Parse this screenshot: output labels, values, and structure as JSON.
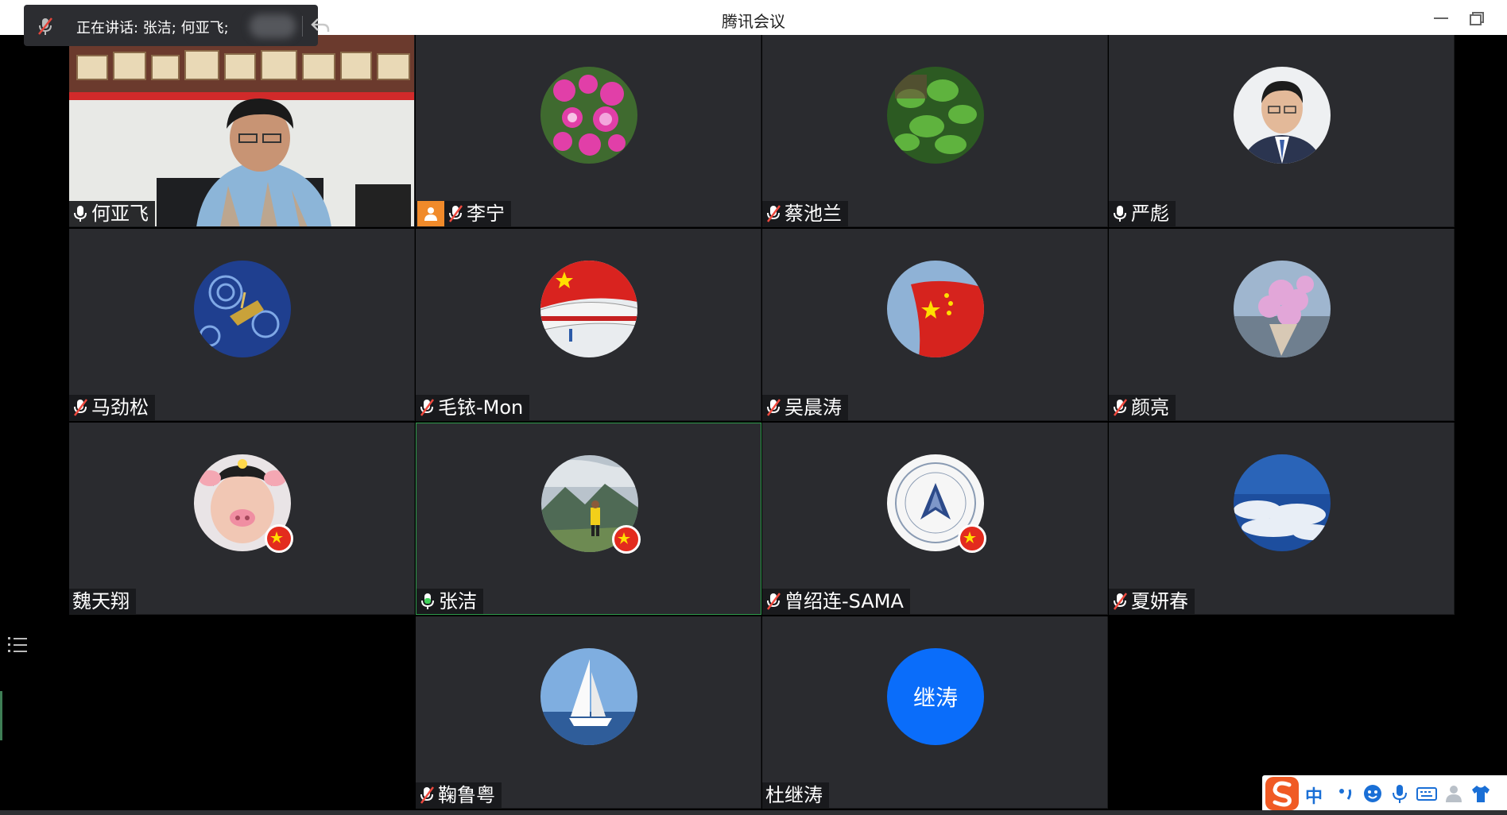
{
  "window": {
    "title": "腾讯会议"
  },
  "speaking": {
    "text": "正在讲话: 张洁; 何亚飞;"
  },
  "participants": [
    {
      "name": "何亚飞",
      "mic": "on",
      "type": "video"
    },
    {
      "name": "李宁",
      "mic": "off",
      "host": true,
      "avatar": "flowers-pink"
    },
    {
      "name": "蔡池兰",
      "mic": "off",
      "avatar": "plants-green"
    },
    {
      "name": "严彪",
      "mic": "on",
      "avatar": "portrait-man"
    },
    {
      "name": "马劲松",
      "mic": "off",
      "avatar": "starry-night-boat"
    },
    {
      "name": "毛铱-Mon",
      "mic": "off",
      "avatar": "airplane-flag"
    },
    {
      "name": "吴晨涛",
      "mic": "off",
      "avatar": "china-flag"
    },
    {
      "name": "颜亮",
      "mic": "off",
      "avatar": "bouquet"
    },
    {
      "name": "魏天翔",
      "mic": "none",
      "avatar": "pig-face-filter"
    },
    {
      "name": "张洁",
      "mic": "speaking",
      "active": true,
      "avatar": "mountain-person"
    },
    {
      "name": "曾绍连-SAMA",
      "mic": "off",
      "avatar": "association-logo"
    },
    {
      "name": "夏妍春",
      "mic": "off",
      "avatar": "clouds-sky"
    },
    {
      "name": "鞠鲁粤",
      "mic": "off",
      "avatar": "sailboat"
    },
    {
      "name": "杜继涛",
      "mic": "none",
      "avatar": "text-initials",
      "initials": "继涛"
    }
  ],
  "ime": {
    "mode": "中"
  },
  "colors": {
    "tile_bg": "#2a2b2f",
    "host_badge": "#f08a2a",
    "active_border": "#2f9a4c",
    "initials_avatar": "#0a6dfa"
  }
}
